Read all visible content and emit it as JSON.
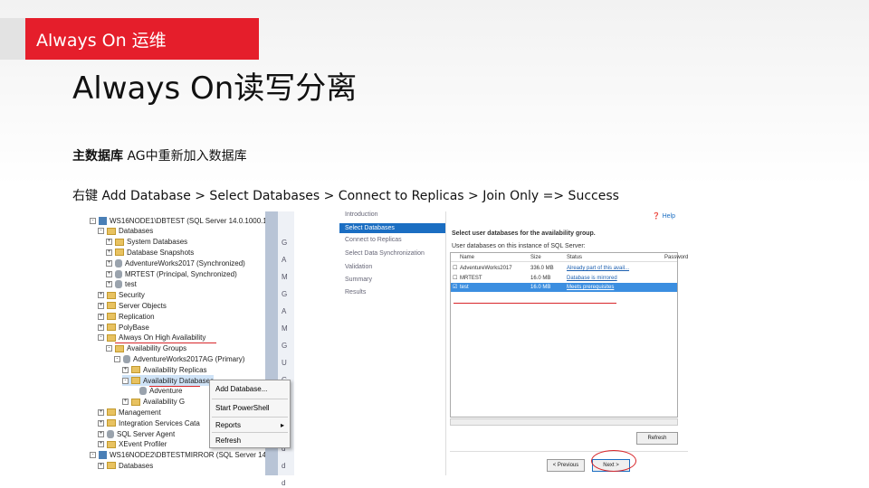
{
  "header": {
    "tag": "Always On 运维",
    "title": "Always On读写分离",
    "line1_bold": "主数据库",
    "line1_rest": " AG中重新加入数据库",
    "line2": "右键  Add Database > Select Databases > Connect to Replicas > Join Only => Success"
  },
  "colors": {
    "accent": "#e51e2b",
    "selection": "#3b8ee0",
    "annotation": "#d8262a"
  },
  "tree": {
    "items": [
      {
        "label": "WS16NODE1\\DBTEST (SQL Server 14.0.1000.1",
        "icon": "server-icon",
        "indent": 0,
        "toggle": "-"
      },
      {
        "label": "Databases",
        "icon": "folder-icon",
        "indent": 1,
        "toggle": "-"
      },
      {
        "label": "System Databases",
        "icon": "folder-icon",
        "indent": 2,
        "toggle": "+"
      },
      {
        "label": "Database Snapshots",
        "icon": "folder-icon",
        "indent": 2,
        "toggle": "+"
      },
      {
        "label": "AdventureWorks2017 (Synchronized)",
        "icon": "database-icon",
        "indent": 2,
        "toggle": "+"
      },
      {
        "label": "MRTEST (Principal, Synchronized)",
        "icon": "database-icon",
        "indent": 2,
        "toggle": "+"
      },
      {
        "label": "test",
        "icon": "database-icon",
        "indent": 2,
        "toggle": "+"
      },
      {
        "label": "Security",
        "icon": "folder-icon",
        "indent": 1,
        "toggle": "+"
      },
      {
        "label": "Server Objects",
        "icon": "folder-icon",
        "indent": 1,
        "toggle": "+"
      },
      {
        "label": "Replication",
        "icon": "folder-icon",
        "indent": 1,
        "toggle": "+"
      },
      {
        "label": "PolyBase",
        "icon": "folder-icon",
        "indent": 1,
        "toggle": "+"
      },
      {
        "label": "Always On High Availability",
        "icon": "folder-icon",
        "indent": 1,
        "toggle": "-"
      },
      {
        "label": "Availability Groups",
        "icon": "folder-icon",
        "indent": 2,
        "toggle": "-"
      },
      {
        "label": "AdventureWorks2017AG (Primary)",
        "icon": "database-icon",
        "indent": 3,
        "toggle": "-"
      },
      {
        "label": "Availability Replicas",
        "icon": "folder-icon",
        "indent": 4,
        "toggle": "+"
      },
      {
        "label": "Availability Databases",
        "icon": "folder-icon",
        "indent": 4,
        "toggle": "-",
        "selected": true
      },
      {
        "label": "Adventure",
        "icon": "database-icon",
        "indent": 5,
        "toggle": ""
      },
      {
        "label": "Availability G",
        "icon": "folder-icon",
        "indent": 4,
        "toggle": "+"
      },
      {
        "label": "Management",
        "icon": "folder-icon",
        "indent": 1,
        "toggle": "+"
      },
      {
        "label": "Integration Services Cata",
        "icon": "folder-icon",
        "indent": 1,
        "toggle": "+"
      },
      {
        "label": "SQL Server Agent",
        "icon": "database-icon",
        "indent": 1,
        "toggle": "+"
      },
      {
        "label": "XEvent Profiler",
        "icon": "folder-icon",
        "indent": 1,
        "toggle": "+"
      },
      {
        "label": "WS16NODE2\\DBTESTMIRROR (SQL Server 14",
        "icon": "server-icon",
        "indent": 0,
        "toggle": "-"
      },
      {
        "label": "Databases",
        "icon": "folder-icon",
        "indent": 1,
        "toggle": "+"
      }
    ]
  },
  "side_strip": [
    "G",
    "A",
    "M",
    "G",
    "A",
    "M",
    "G",
    "U",
    "G",
    "A",
    "A",
    "G",
    "d",
    "d",
    "d"
  ],
  "context_menu": {
    "items": [
      "Add Database...",
      "Start PowerShell",
      "Reports",
      "Refresh"
    ]
  },
  "wizard": {
    "help": "Help",
    "nav": [
      "Introduction",
      "Select Databases",
      "Connect to Replicas",
      "Select Data Synchronization",
      "Validation",
      "Summary",
      "Results"
    ],
    "nav_active": 1,
    "heading": "Select user databases for the availability group.",
    "subheading": "User databases on this instance of SQL Server:",
    "columns": [
      "Name",
      "Size",
      "Status",
      "Password"
    ],
    "rows": [
      {
        "name": "AdventureWorks2017",
        "size": "336.0 MB",
        "status": "Already part of this avail...",
        "selected": false
      },
      {
        "name": "MRTEST",
        "size": "16.0 MB",
        "status": "Database is mirrored",
        "selected": false
      },
      {
        "name": "test",
        "size": "16.0 MB",
        "status": "Meets prerequisites",
        "selected": true
      }
    ],
    "refresh": "Refresh",
    "previous": "< Previous",
    "next": "Next >"
  }
}
